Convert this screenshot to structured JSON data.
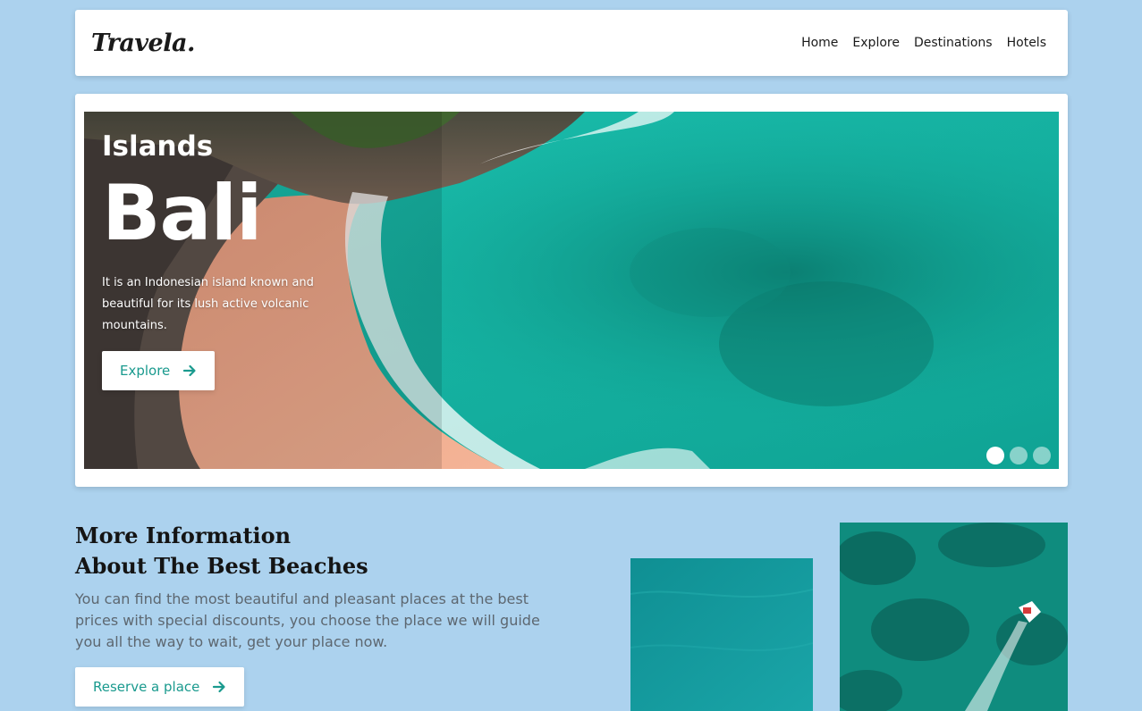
{
  "header": {
    "logo": "Travela.",
    "nav": [
      "Home",
      "Explore",
      "Destinations",
      "Hotels"
    ]
  },
  "hero": {
    "subtitle": "Islands",
    "title": "Bali",
    "description": "It is an Indonesian island known and beautiful for its lush active volcanic mountains.",
    "button_label": "Explore",
    "slides_count": 3,
    "active_slide": 1
  },
  "info": {
    "title_line1": "More Information",
    "title_line2": "About The Best Beaches",
    "description": "You can find the most beautiful and pleasant places at the best prices with special discounts, you choose the place we will guide you all the way to wait, get your place now.",
    "button_label": "Reserve a place"
  },
  "icons": {
    "button_arrow": "arrow-right-icon"
  },
  "colors": {
    "page_background": "#acd2ee",
    "accent": "#1a9a8e",
    "sea": "#16b3a4",
    "sand": "#efa98a"
  }
}
